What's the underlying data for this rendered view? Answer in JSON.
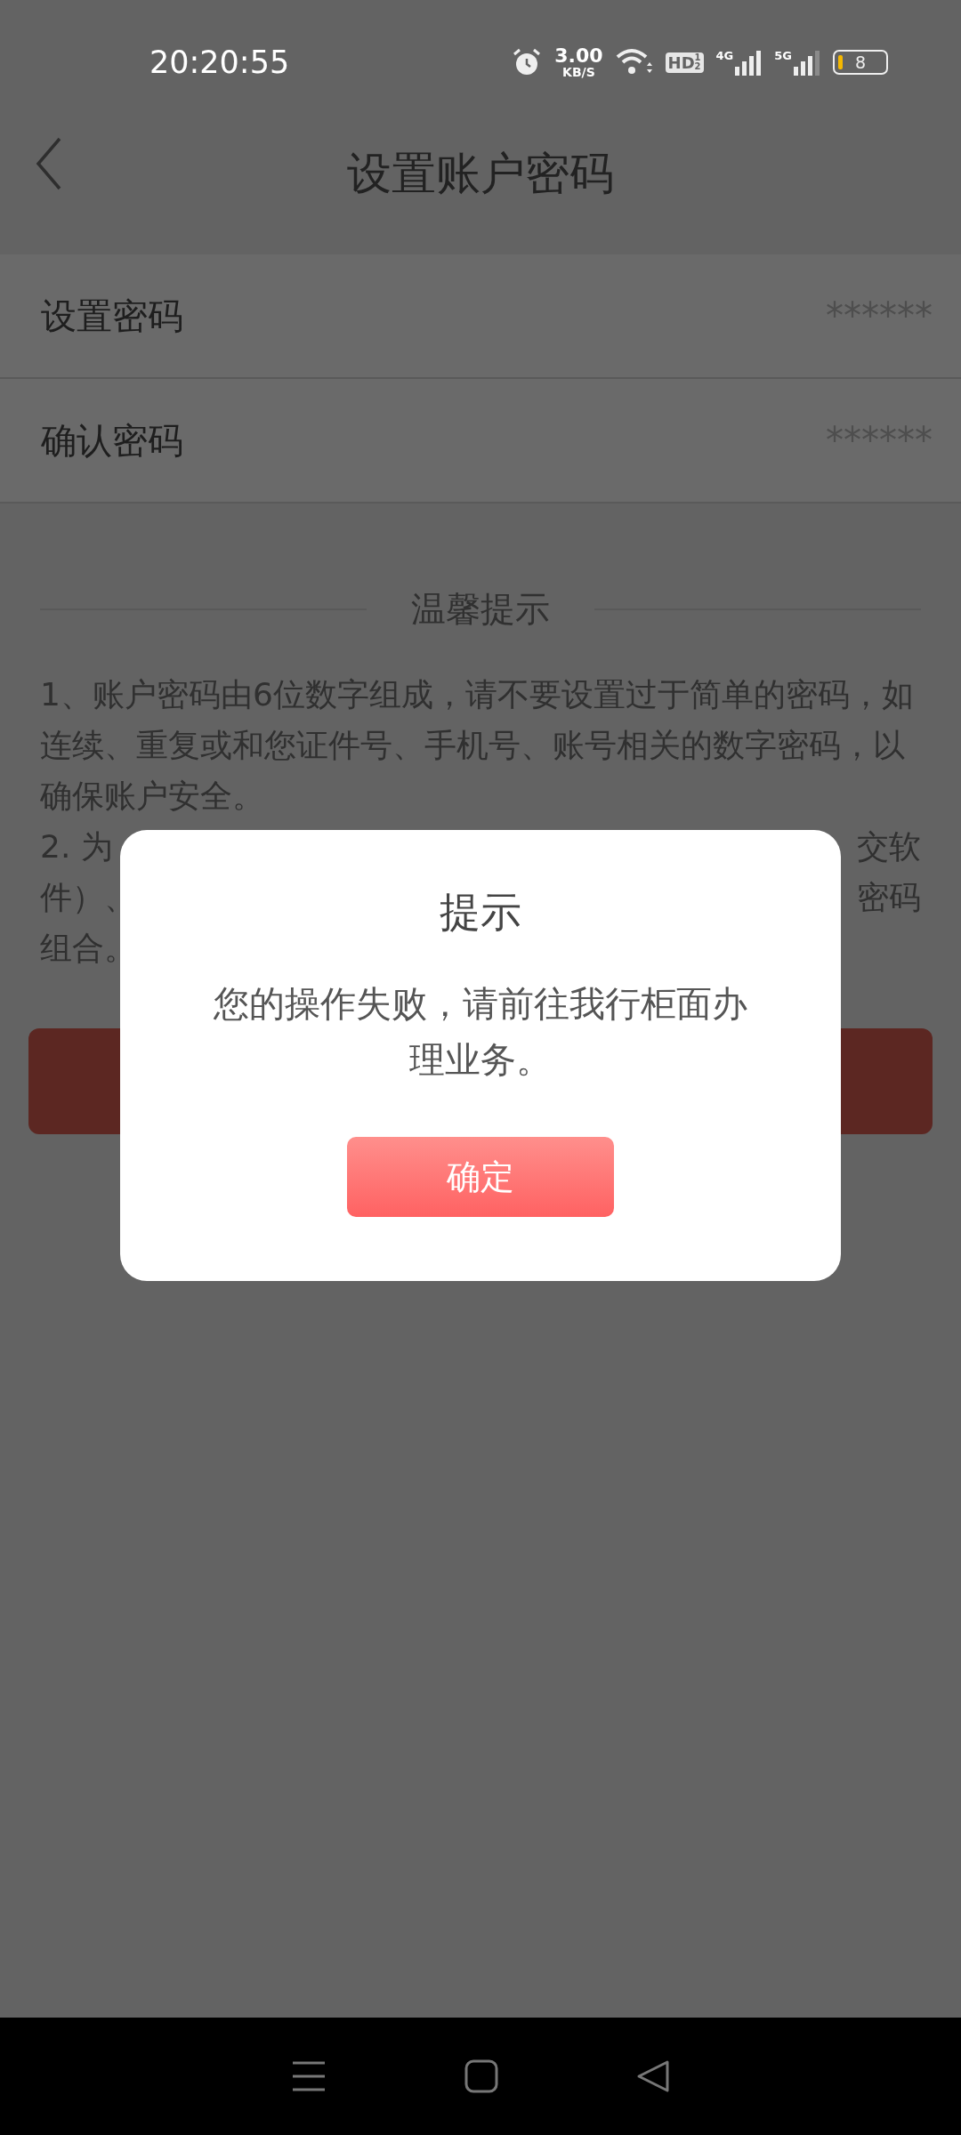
{
  "status_bar": {
    "time": "20:20:55",
    "speed": "3.00",
    "speed_unit": "KB/S",
    "hd_badge": "HD",
    "hd_sup": "1",
    "hd_sub": "2",
    "networks": [
      "4G",
      "5G"
    ],
    "battery": "8"
  },
  "header": {
    "title": "设置账户密码"
  },
  "fields": [
    {
      "label": "设置密码",
      "placeholder": "******"
    },
    {
      "label": "确认密码",
      "placeholder": "******"
    }
  ],
  "tips": {
    "title": "温馨提示",
    "paragraph_1": "1、账户密码由6位数字组成，请不要设置过于简单的密码，如连续、重复或和您证件号、手机号、账号相关的数字密码，以确保账户安全。",
    "paragraph_2_lines": [
      {
        "left": "2. 为",
        "right": "交软"
      },
      {
        "left": "件）、",
        "right": "密码"
      },
      {
        "left": "组合。"
      }
    ]
  },
  "dialog": {
    "title": "提示",
    "message": "您的操作失败，请前往我行柜面办理业务。",
    "button": "确定"
  }
}
